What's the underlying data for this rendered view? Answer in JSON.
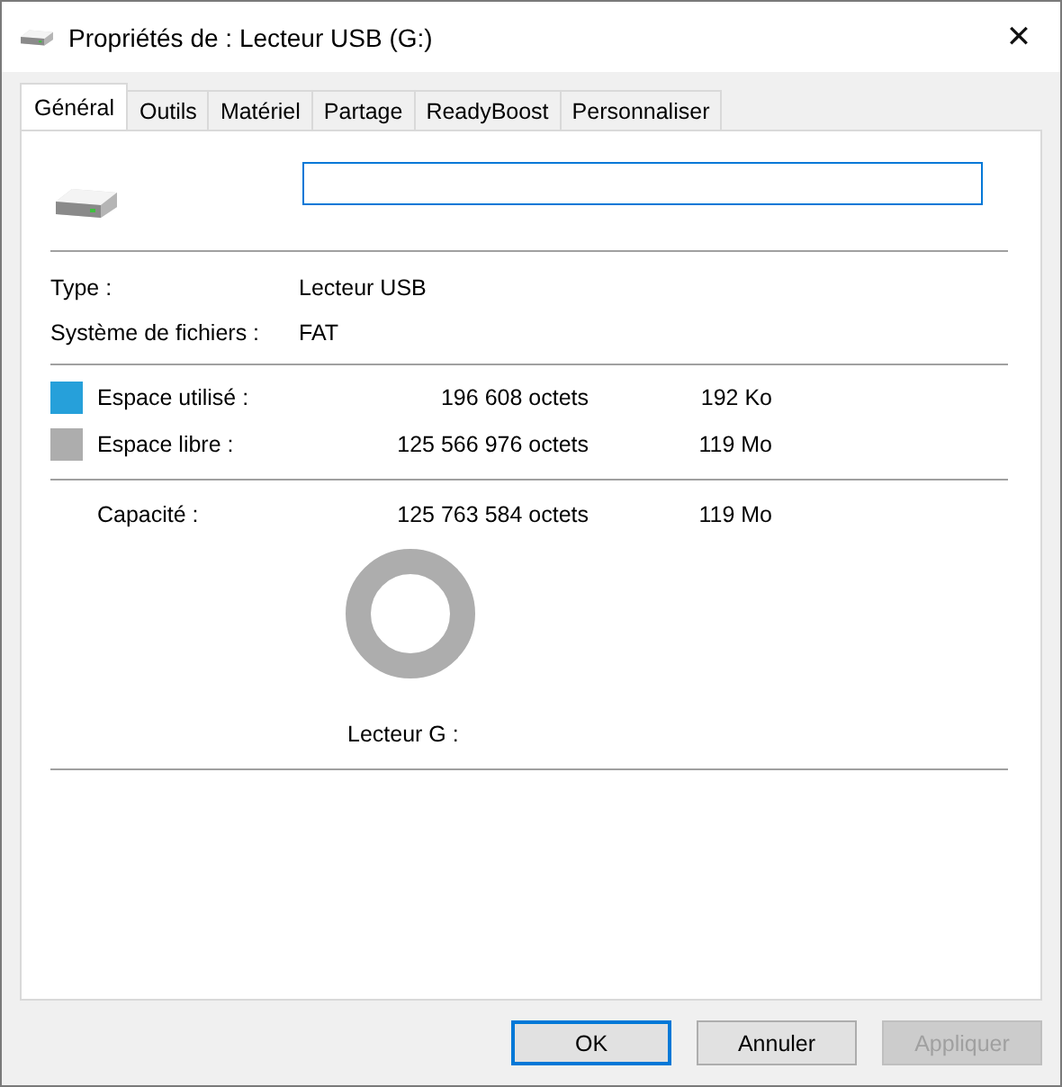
{
  "window": {
    "title": "Propriétés de : Lecteur USB (G:)",
    "close": "✕"
  },
  "tabs": [
    {
      "label": "Général",
      "selected": true
    },
    {
      "label": "Outils",
      "selected": false
    },
    {
      "label": "Matériel",
      "selected": false
    },
    {
      "label": "Partage",
      "selected": false
    },
    {
      "label": "ReadyBoost",
      "selected": false
    },
    {
      "label": "Personnaliser",
      "selected": false
    }
  ],
  "name_field": {
    "focused": true
  },
  "info": [
    {
      "label": "Type :",
      "value": "Lecteur USB"
    },
    {
      "label": "Système de fichiers :",
      "value": "FAT"
    }
  ],
  "space": [
    {
      "label": "Espace utilisé :",
      "bytes": "196 608 octets",
      "size": "192 Ko",
      "color": "#26a0da"
    },
    {
      "label": "Espace libre :",
      "bytes": "125 566 976 octets",
      "size": "119 Mo",
      "color": "#adadad"
    }
  ],
  "capacity": {
    "label": "Capacité :",
    "bytes": "125 763 584 octets",
    "size": "119 Mo"
  },
  "drive_label": "Lecteur G :",
  "buttons": [
    {
      "label": "OK",
      "default": true,
      "disabled": false
    },
    {
      "label": "Annuler",
      "default": false,
      "disabled": false
    },
    {
      "label": "Appliquer",
      "default": false,
      "disabled": true
    }
  ]
}
